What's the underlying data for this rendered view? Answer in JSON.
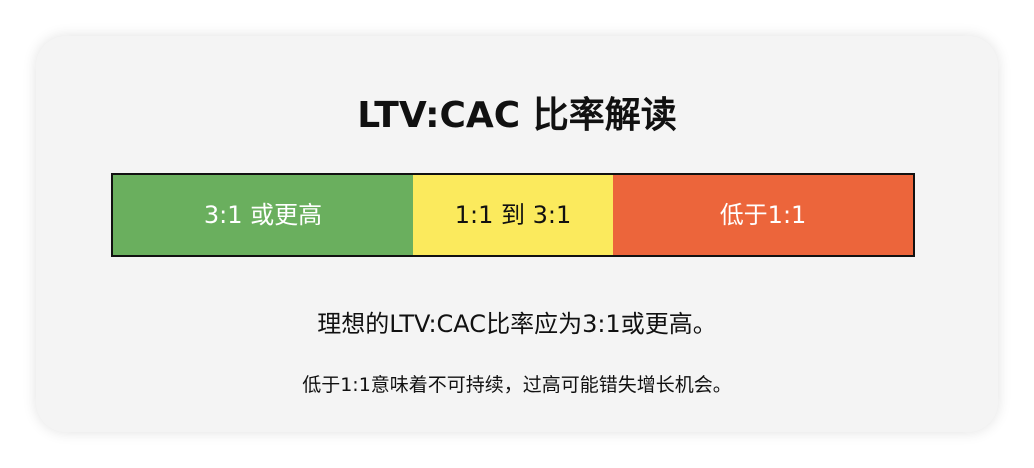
{
  "title": "LTV:CAC 比率解读",
  "segments": [
    {
      "label": "3:1 或更高",
      "color": "#6aaf5e"
    },
    {
      "label": "1:1 到 3:1",
      "color": "#fbea5d"
    },
    {
      "label": "低于1:1",
      "color": "#ec653b"
    }
  ],
  "description": {
    "primary": "理想的LTV:CAC比率应为3:1或更高。",
    "secondary": "低于1:1意味着不可持续，过高可能错失增长机会。"
  }
}
